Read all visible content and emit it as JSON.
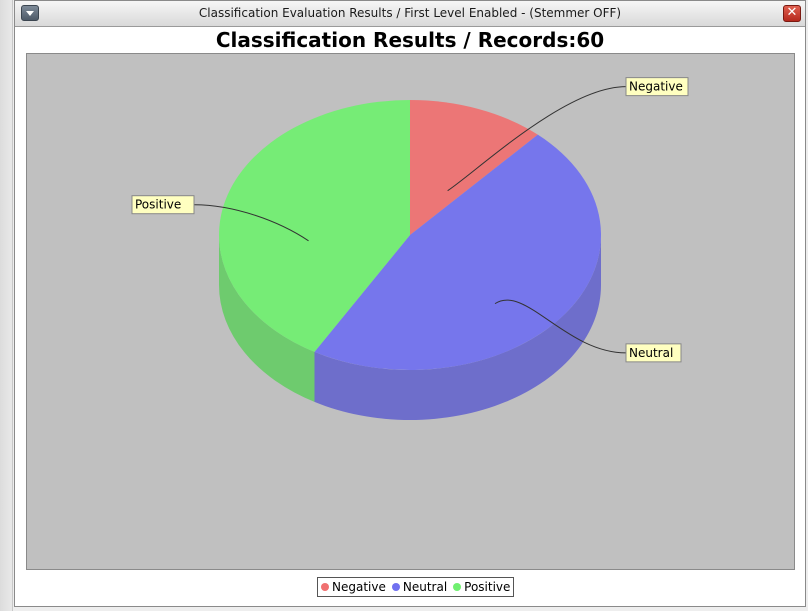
{
  "window": {
    "title": "Classification Evaluation Results / First Level Enabled - (Stemmer OFF)",
    "close_glyph": "✕"
  },
  "chart_data": {
    "type": "pie",
    "title": "Classification Results / Records:60",
    "slices": [
      {
        "label": "Negative",
        "value": 7,
        "color": "#f07070"
      },
      {
        "label": "Neutral",
        "value": 28,
        "color": "#7070f0"
      },
      {
        "label": "Positive",
        "value": 25,
        "color": "#70f070"
      }
    ],
    "legend_position": "bottom",
    "style": "3d"
  },
  "colors": {
    "plot_background": "#c0c0c0",
    "label_background": "#ffffc0"
  }
}
